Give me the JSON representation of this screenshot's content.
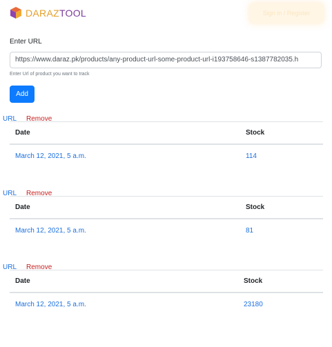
{
  "header": {
    "logo_part1": "DARAZ",
    "logo_part2": "TOOL",
    "button_label": "Sign in / Register"
  },
  "form": {
    "label": "Enter URL",
    "value": "https://www.daraz.pk/products/any-product-url-some-product-url-i193758646-s1387782035.h",
    "help": "Enter Url of product you want to track",
    "add_label": "Add"
  },
  "table_headers": {
    "date": "Date",
    "stock": "Stock"
  },
  "trackers": [
    {
      "url_label": "URL",
      "remove_label": "Remove",
      "date": "March 12, 2021, 5 a.m.",
      "stock": "114"
    },
    {
      "url_label": "URL",
      "remove_label": "Remove",
      "date": "March 12, 2021, 5 a.m.",
      "stock": "81"
    },
    {
      "url_label": "URL",
      "remove_label": "Remove",
      "date": "March 12, 2021, 5 a.m.",
      "stock": "23180"
    }
  ],
  "colors": {
    "primary": "#0d7bff",
    "link": "#1a6fdf",
    "danger": "#c81e1e",
    "logo_orange": "#e5a02a",
    "logo_purple": "#7a3a9a"
  }
}
